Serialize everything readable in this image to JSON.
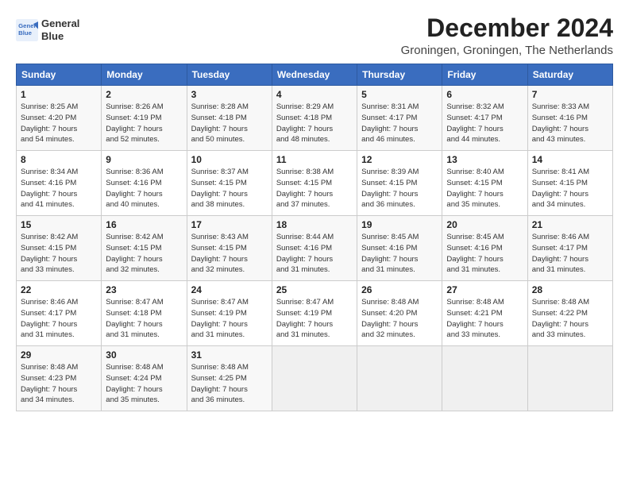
{
  "logo": {
    "line1": "General",
    "line2": "Blue"
  },
  "title": "December 2024",
  "subtitle": "Groningen, Groningen, The Netherlands",
  "weekdays": [
    "Sunday",
    "Monday",
    "Tuesday",
    "Wednesday",
    "Thursday",
    "Friday",
    "Saturday"
  ],
  "weeks": [
    [
      {
        "day": "1",
        "info": "Sunrise: 8:25 AM\nSunset: 4:20 PM\nDaylight: 7 hours\nand 54 minutes."
      },
      {
        "day": "2",
        "info": "Sunrise: 8:26 AM\nSunset: 4:19 PM\nDaylight: 7 hours\nand 52 minutes."
      },
      {
        "day": "3",
        "info": "Sunrise: 8:28 AM\nSunset: 4:18 PM\nDaylight: 7 hours\nand 50 minutes."
      },
      {
        "day": "4",
        "info": "Sunrise: 8:29 AM\nSunset: 4:18 PM\nDaylight: 7 hours\nand 48 minutes."
      },
      {
        "day": "5",
        "info": "Sunrise: 8:31 AM\nSunset: 4:17 PM\nDaylight: 7 hours\nand 46 minutes."
      },
      {
        "day": "6",
        "info": "Sunrise: 8:32 AM\nSunset: 4:17 PM\nDaylight: 7 hours\nand 44 minutes."
      },
      {
        "day": "7",
        "info": "Sunrise: 8:33 AM\nSunset: 4:16 PM\nDaylight: 7 hours\nand 43 minutes."
      }
    ],
    [
      {
        "day": "8",
        "info": "Sunrise: 8:34 AM\nSunset: 4:16 PM\nDaylight: 7 hours\nand 41 minutes."
      },
      {
        "day": "9",
        "info": "Sunrise: 8:36 AM\nSunset: 4:16 PM\nDaylight: 7 hours\nand 40 minutes."
      },
      {
        "day": "10",
        "info": "Sunrise: 8:37 AM\nSunset: 4:15 PM\nDaylight: 7 hours\nand 38 minutes."
      },
      {
        "day": "11",
        "info": "Sunrise: 8:38 AM\nSunset: 4:15 PM\nDaylight: 7 hours\nand 37 minutes."
      },
      {
        "day": "12",
        "info": "Sunrise: 8:39 AM\nSunset: 4:15 PM\nDaylight: 7 hours\nand 36 minutes."
      },
      {
        "day": "13",
        "info": "Sunrise: 8:40 AM\nSunset: 4:15 PM\nDaylight: 7 hours\nand 35 minutes."
      },
      {
        "day": "14",
        "info": "Sunrise: 8:41 AM\nSunset: 4:15 PM\nDaylight: 7 hours\nand 34 minutes."
      }
    ],
    [
      {
        "day": "15",
        "info": "Sunrise: 8:42 AM\nSunset: 4:15 PM\nDaylight: 7 hours\nand 33 minutes."
      },
      {
        "day": "16",
        "info": "Sunrise: 8:42 AM\nSunset: 4:15 PM\nDaylight: 7 hours\nand 32 minutes."
      },
      {
        "day": "17",
        "info": "Sunrise: 8:43 AM\nSunset: 4:15 PM\nDaylight: 7 hours\nand 32 minutes."
      },
      {
        "day": "18",
        "info": "Sunrise: 8:44 AM\nSunset: 4:16 PM\nDaylight: 7 hours\nand 31 minutes."
      },
      {
        "day": "19",
        "info": "Sunrise: 8:45 AM\nSunset: 4:16 PM\nDaylight: 7 hours\nand 31 minutes."
      },
      {
        "day": "20",
        "info": "Sunrise: 8:45 AM\nSunset: 4:16 PM\nDaylight: 7 hours\nand 31 minutes."
      },
      {
        "day": "21",
        "info": "Sunrise: 8:46 AM\nSunset: 4:17 PM\nDaylight: 7 hours\nand 31 minutes."
      }
    ],
    [
      {
        "day": "22",
        "info": "Sunrise: 8:46 AM\nSunset: 4:17 PM\nDaylight: 7 hours\nand 31 minutes."
      },
      {
        "day": "23",
        "info": "Sunrise: 8:47 AM\nSunset: 4:18 PM\nDaylight: 7 hours\nand 31 minutes."
      },
      {
        "day": "24",
        "info": "Sunrise: 8:47 AM\nSunset: 4:19 PM\nDaylight: 7 hours\nand 31 minutes."
      },
      {
        "day": "25",
        "info": "Sunrise: 8:47 AM\nSunset: 4:19 PM\nDaylight: 7 hours\nand 31 minutes."
      },
      {
        "day": "26",
        "info": "Sunrise: 8:48 AM\nSunset: 4:20 PM\nDaylight: 7 hours\nand 32 minutes."
      },
      {
        "day": "27",
        "info": "Sunrise: 8:48 AM\nSunset: 4:21 PM\nDaylight: 7 hours\nand 33 minutes."
      },
      {
        "day": "28",
        "info": "Sunrise: 8:48 AM\nSunset: 4:22 PM\nDaylight: 7 hours\nand 33 minutes."
      }
    ],
    [
      {
        "day": "29",
        "info": "Sunrise: 8:48 AM\nSunset: 4:23 PM\nDaylight: 7 hours\nand 34 minutes."
      },
      {
        "day": "30",
        "info": "Sunrise: 8:48 AM\nSunset: 4:24 PM\nDaylight: 7 hours\nand 35 minutes."
      },
      {
        "day": "31",
        "info": "Sunrise: 8:48 AM\nSunset: 4:25 PM\nDaylight: 7 hours\nand 36 minutes."
      },
      null,
      null,
      null,
      null
    ]
  ]
}
